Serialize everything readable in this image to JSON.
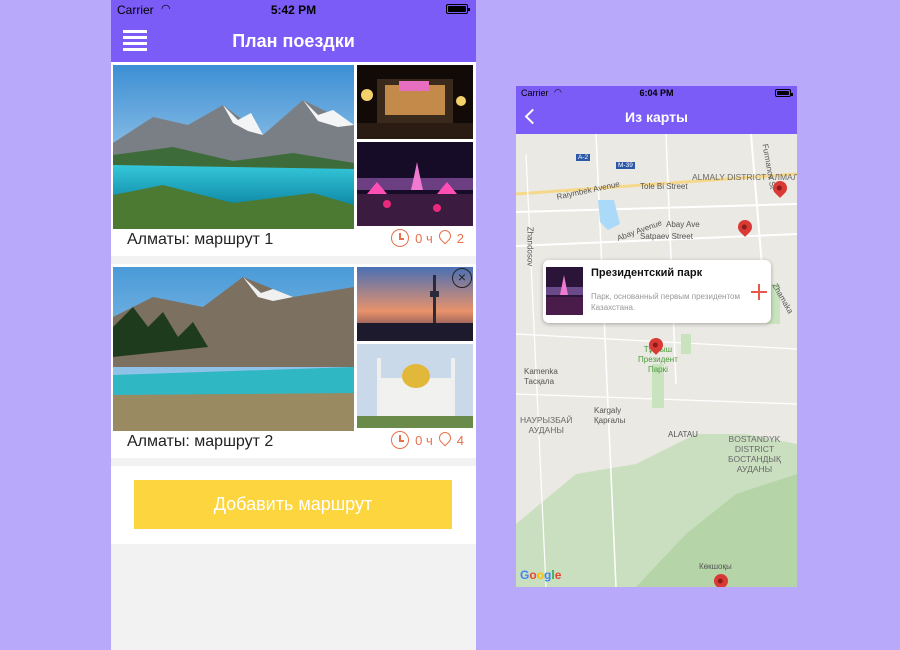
{
  "left_phone": {
    "status": {
      "carrier": "Carrier",
      "time": "5:42 PM"
    },
    "header": {
      "title": "План поездки"
    },
    "routes": [
      {
        "name": "Алматы: маршрут 1",
        "duration": "0 ч",
        "places": "2"
      },
      {
        "name": "Алматы: маршрут 2",
        "duration": "0 ч",
        "places": "4"
      }
    ],
    "add_button_label": "Добавить маршрут"
  },
  "right_phone": {
    "status": {
      "carrier": "Carrier",
      "time": "6:04 PM"
    },
    "header": {
      "title": "Из карты"
    },
    "popup": {
      "title": "Президентский парк",
      "description": "Парк, основанный первым президентом Казахстана."
    },
    "map_labels": {
      "a2": "A-2",
      "m39": "M-39",
      "raiymbek": "Raiymbek Avenue",
      "tole_bi": "Tole Bi Street",
      "almaly": "ALMALY DISTRICT\nАЛМАЛЫ\nАУДАНЫ",
      "abay": "Abay Ave",
      "abay_ave": "Abay Avenue",
      "satpaev": "Satpaev Street",
      "furmanov": "Furmanov St",
      "zhandosov": "Zhandosov",
      "zhamakaev": "Zhamaka",
      "park": "Тұңғыш\nПрезидент\nПаркі",
      "kamenka": "Kamenka\nТасқала",
      "kargaly": "Kargaly\nҚарғалы",
      "nauryzbai": "НАУРЫЗБАЙ\nАУДАНЫ",
      "alatau": "ALATAU",
      "bostandyk": "BOSTANDYK\nDISTRICT\nБОСТАНДЫҚ\nАУДАНЫ",
      "koksho": "Көкшоқы",
      "google": "Google"
    }
  },
  "colors": {
    "accent": "#7b5cf6",
    "background": "#b8a9fb",
    "button": "#fcd53f",
    "icon": "#e8704a"
  }
}
